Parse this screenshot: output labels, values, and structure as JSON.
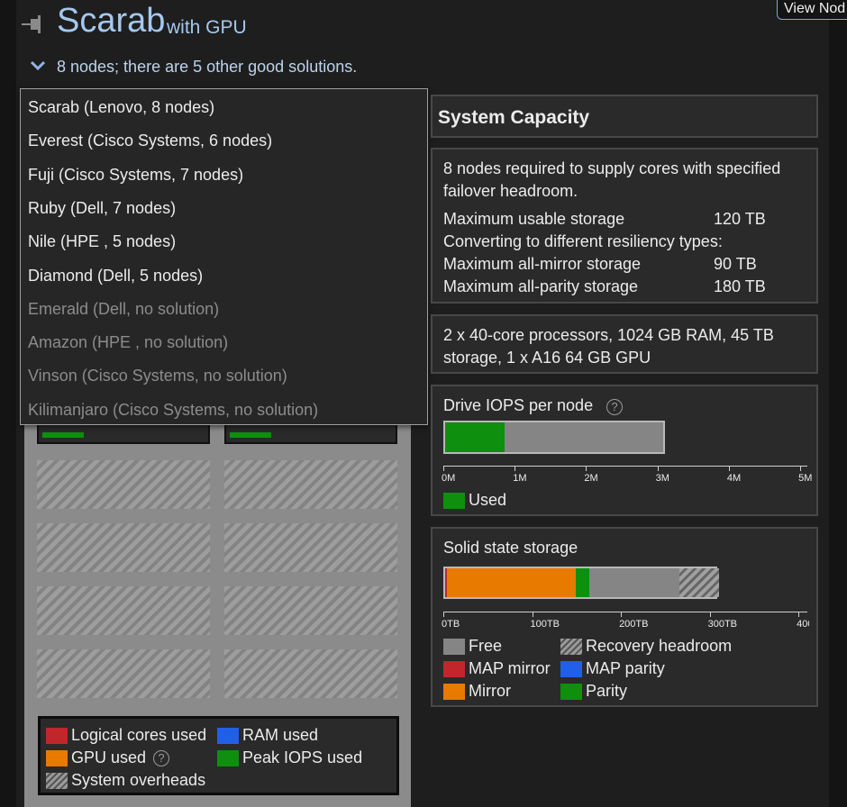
{
  "header": {
    "title": "Scarab",
    "subtitle": "with GPU",
    "nodes_summary": "8 nodes; there are 5 other good solutions.",
    "view_node_button": "View Nod"
  },
  "dropdown": {
    "items": [
      {
        "label": "Scarab (Lenovo, 8 nodes)",
        "available": true
      },
      {
        "label": "Everest (Cisco Systems, 6 nodes)",
        "available": true
      },
      {
        "label": "Fuji (Cisco Systems, 7 nodes)",
        "available": true
      },
      {
        "label": "Ruby (Dell, 7 nodes)",
        "available": true
      },
      {
        "label": "Nile (HPE , 5 nodes)",
        "available": true
      },
      {
        "label": "Diamond (Dell, 5 nodes)",
        "available": true
      },
      {
        "label": "Emerald (Dell, no solution)",
        "available": false
      },
      {
        "label": "Amazon (HPE , no solution)",
        "available": false
      },
      {
        "label": "Vinson (Cisco Systems, no solution)",
        "available": false
      },
      {
        "label": "Kilimanjaro (Cisco Systems, no solution)",
        "available": false
      }
    ]
  },
  "node_legend": {
    "logical_cores": "Logical cores used",
    "ram": "RAM used",
    "gpu": "GPU used",
    "peak_iops": "Peak IOPS used",
    "overheads": "System overheads"
  },
  "capacity": {
    "title": "System Capacity",
    "requirement_line1": "8 nodes required to supply cores with specified",
    "requirement_line2": "failover headroom.",
    "max_usable_label": "Maximum usable storage",
    "max_usable_value": "120 TB",
    "converting_label": "Converting to different resiliency types:",
    "all_mirror_label": "Maximum all-mirror storage",
    "all_mirror_value": "90 TB",
    "all_parity_label": "Maximum all-parity storage",
    "all_parity_value": "180 TB"
  },
  "hardware": {
    "line1": "2 x 40-core processors, 1024 GB RAM, 45 TB",
    "line2": "storage, 1 x A16 64 GB GPU"
  },
  "iops": {
    "title": "Drive IOPS per node",
    "ticks": [
      "0M",
      "1M",
      "2M",
      "3M",
      "4M",
      "5M"
    ],
    "used_legend": "Used",
    "used_millions": 0.83,
    "capacity_millions": 3.1,
    "axis_max_millions": 5.1
  },
  "storage": {
    "title": "Solid state storage",
    "ticks": [
      "0TB",
      "100TB",
      "200TB",
      "300TB",
      "400"
    ],
    "axis_max_tb": 410,
    "legend": {
      "free": "Free",
      "recovery": "Recovery headroom",
      "map_mirror": "MAP mirror",
      "map_parity": "MAP parity",
      "mirror": "Mirror",
      "parity": "Parity"
    },
    "segments_tb": {
      "map_mirror": 2,
      "mirror": 145,
      "parity": 15,
      "free": 102,
      "recovery": 45
    }
  },
  "colors": {
    "accent_title": "#a5c8ef",
    "logical_cores": "#c0262b",
    "ram": "#2060e6",
    "gpu": "#e87a00",
    "iops": "#0e8f0e",
    "free": "#858585"
  }
}
